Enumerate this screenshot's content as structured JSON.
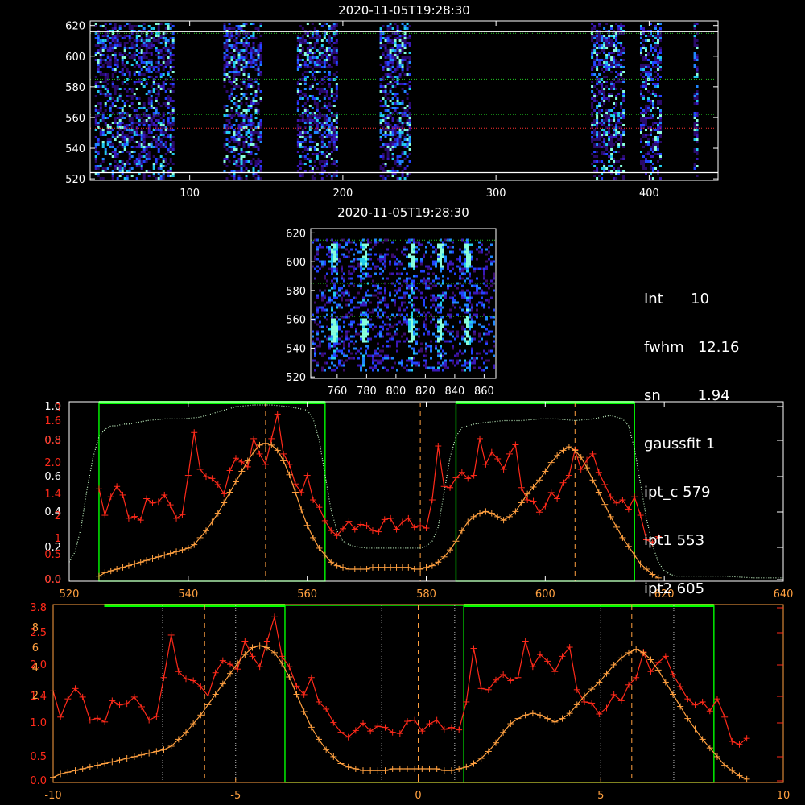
{
  "colors": {
    "axis": "#ffffff",
    "red": "#ff2a1a",
    "orange": "#ffa040",
    "green": "#00ff00",
    "green_dot": "#ccffcc",
    "dim_dot": "#bbbbbb"
  },
  "info": [
    {
      "key": "Int",
      "value": "10"
    },
    {
      "key": "fwhm",
      "value": "12.16"
    },
    {
      "key": "sn",
      "value": "1.94"
    },
    {
      "key": "gaussfit",
      "value": "1"
    },
    {
      "key": "ipt_c",
      "value": "579"
    },
    {
      "key": "ipt1",
      "value": "553"
    },
    {
      "key": "ipt2",
      "value": "605"
    }
  ],
  "chart_data": [
    {
      "type": "heatmap",
      "title": "2020-11-05T19:28:30",
      "xlim": [
        35,
        445
      ],
      "ylim": [
        519,
        623
      ],
      "xticks": [
        100,
        200,
        300,
        400
      ],
      "yticks": [
        520,
        540,
        560,
        580,
        600,
        620
      ],
      "bands": [
        [
          38,
          90
        ],
        [
          122,
          146
        ],
        [
          170,
          196
        ],
        [
          224,
          244
        ],
        [
          362,
          384
        ],
        [
          394,
          408
        ],
        [
          429,
          432
        ]
      ],
      "hlines": [
        {
          "y": 616,
          "color": "white"
        },
        {
          "y": 524,
          "color": "white"
        },
        {
          "y": 615,
          "color": "green"
        },
        {
          "y": 585,
          "color": "green"
        },
        {
          "y": 562,
          "color": "green"
        },
        {
          "y": 553,
          "color": "red"
        }
      ]
    },
    {
      "type": "heatmap",
      "title": "2020-11-05T19:28:30",
      "xlim": [
        742,
        868
      ],
      "ylim": [
        519,
        623
      ],
      "xticks": [
        760,
        780,
        800,
        820,
        840,
        860
      ],
      "yticks": [
        520,
        540,
        560,
        580,
        600,
        620
      ],
      "hot_columns": [
        757,
        778,
        810,
        830,
        848
      ],
      "hlines": [
        {
          "y": 615,
          "color": "green"
        },
        {
          "y": 585,
          "color": "green"
        },
        {
          "y": 562,
          "color": "green"
        }
      ]
    },
    {
      "type": "line",
      "xlim": [
        520,
        640
      ],
      "xticks": [
        520,
        540,
        560,
        580,
        600,
        620,
        640
      ],
      "left_ticks_red": [
        "0.0",
        "0.5",
        "1",
        "2",
        "1.4",
        "2.0",
        "0.8",
        "1.6",
        "3"
      ],
      "left_ticks_white": [
        "0.0",
        "0.2",
        "0.4",
        "0.6",
        "0.8",
        "1.0"
      ],
      "green_boxes": [
        [
          525,
          563
        ],
        [
          585,
          615
        ]
      ],
      "vlines_dashed": [
        553,
        579,
        605
      ],
      "series": [
        {
          "role": "red",
          "x": [
            525,
            526,
            527,
            528,
            529,
            530,
            531,
            532,
            533,
            534,
            535,
            536,
            537,
            538,
            539,
            540,
            541,
            542,
            543,
            544,
            545,
            546,
            547,
            548,
            549,
            550,
            551,
            552,
            553,
            554,
            555,
            556,
            557,
            558,
            559,
            560,
            561,
            562,
            563,
            564,
            565,
            566,
            567,
            568,
            569,
            570,
            571,
            572,
            573,
            574,
            575,
            576,
            577,
            578,
            579,
            580,
            581,
            582,
            583,
            584,
            585,
            586,
            587,
            588,
            589,
            590,
            591,
            592,
            593,
            594,
            595,
            596,
            597,
            598,
            599,
            600,
            601,
            602,
            603,
            604,
            605,
            606,
            607,
            608,
            609,
            610,
            611,
            612,
            613,
            614,
            615,
            616,
            617,
            618,
            619
          ],
          "y": [
            1.48,
            1.05,
            1.35,
            1.52,
            1.38,
            1.0,
            1.03,
            0.97,
            1.32,
            1.25,
            1.27,
            1.38,
            1.22,
            1.0,
            1.06,
            1.7,
            2.4,
            1.8,
            1.68,
            1.65,
            1.55,
            1.4,
            1.78,
            1.98,
            1.92,
            1.84,
            2.3,
            2.05,
            1.88,
            2.3,
            2.7,
            2.05,
            1.88,
            1.56,
            1.42,
            1.7,
            1.3,
            1.18,
            0.96,
            0.8,
            0.72,
            0.83,
            0.95,
            0.82,
            0.9,
            0.88,
            0.8,
            0.78,
            0.98,
            1.0,
            0.82,
            0.94,
            1.0,
            0.85,
            0.88,
            0.84,
            1.3,
            2.18,
            1.52,
            1.5,
            1.66,
            1.75,
            1.65,
            1.7,
            2.3,
            1.88,
            2.08,
            1.97,
            1.8,
            2.05,
            2.2,
            1.5,
            1.3,
            1.28,
            1.1,
            1.2,
            1.42,
            1.32,
            1.58,
            1.7,
            2.12,
            1.8,
            1.95,
            2.05,
            1.75,
            1.55,
            1.35,
            1.25,
            1.3,
            1.15,
            1.35,
            1.05,
            0.65,
            0.6,
            0.7
          ]
        },
        {
          "role": "orange",
          "x": [
            525,
            526,
            527,
            528,
            529,
            530,
            531,
            532,
            533,
            534,
            535,
            536,
            537,
            538,
            539,
            540,
            541,
            542,
            543,
            544,
            545,
            546,
            547,
            548,
            549,
            550,
            551,
            552,
            553,
            554,
            555,
            556,
            557,
            558,
            559,
            560,
            561,
            562,
            563,
            564,
            565,
            566,
            567,
            568,
            569,
            570,
            571,
            572,
            573,
            574,
            575,
            576,
            577,
            578,
            579,
            580,
            581,
            582,
            583,
            584,
            585,
            586,
            587,
            588,
            589,
            590,
            591,
            592,
            593,
            594,
            595,
            596,
            597,
            598,
            599,
            600,
            601,
            602,
            603,
            604,
            605,
            606,
            607,
            608,
            609,
            610,
            611,
            612,
            613,
            614,
            615,
            616,
            617,
            618,
            619
          ],
          "y": [
            0.02,
            0.04,
            0.05,
            0.06,
            0.07,
            0.08,
            0.09,
            0.1,
            0.11,
            0.12,
            0.13,
            0.14,
            0.15,
            0.16,
            0.17,
            0.18,
            0.2,
            0.24,
            0.28,
            0.33,
            0.38,
            0.44,
            0.5,
            0.56,
            0.62,
            0.68,
            0.73,
            0.77,
            0.78,
            0.77,
            0.74,
            0.68,
            0.6,
            0.5,
            0.4,
            0.31,
            0.24,
            0.18,
            0.14,
            0.1,
            0.08,
            0.07,
            0.06,
            0.06,
            0.06,
            0.06,
            0.07,
            0.07,
            0.07,
            0.07,
            0.07,
            0.07,
            0.07,
            0.06,
            0.06,
            0.07,
            0.08,
            0.1,
            0.13,
            0.17,
            0.22,
            0.28,
            0.33,
            0.36,
            0.38,
            0.39,
            0.38,
            0.36,
            0.34,
            0.36,
            0.39,
            0.44,
            0.49,
            0.53,
            0.57,
            0.62,
            0.67,
            0.71,
            0.74,
            0.76,
            0.74,
            0.7,
            0.64,
            0.57,
            0.5,
            0.43,
            0.36,
            0.3,
            0.24,
            0.19,
            0.14,
            0.09,
            0.06,
            0.03,
            0.01
          ]
        },
        {
          "role": "green_dotted",
          "x": [
            520,
            521,
            522,
            523,
            524,
            525,
            526,
            527,
            528,
            529,
            530,
            533,
            536,
            539,
            542,
            545,
            548,
            551,
            554,
            557,
            560,
            561,
            562,
            563,
            564,
            565,
            566,
            567,
            568,
            570,
            573,
            576,
            579,
            580,
            581,
            582,
            583,
            584,
            585,
            586,
            587,
            588,
            590,
            593,
            596,
            599,
            602,
            605,
            608,
            611,
            613,
            614,
            615,
            616,
            617,
            618,
            619,
            620,
            621,
            622,
            623,
            625,
            630,
            635,
            640
          ],
          "y": [
            0.1,
            0.16,
            0.3,
            0.52,
            0.7,
            0.82,
            0.86,
            0.88,
            0.88,
            0.89,
            0.89,
            0.91,
            0.92,
            0.92,
            0.93,
            0.96,
            0.99,
            1.0,
            1.0,
            0.99,
            0.97,
            0.92,
            0.8,
            0.6,
            0.4,
            0.28,
            0.22,
            0.2,
            0.19,
            0.18,
            0.18,
            0.18,
            0.18,
            0.19,
            0.22,
            0.3,
            0.5,
            0.7,
            0.82,
            0.87,
            0.88,
            0.89,
            0.9,
            0.91,
            0.91,
            0.92,
            0.92,
            0.91,
            0.92,
            0.94,
            0.92,
            0.88,
            0.75,
            0.55,
            0.35,
            0.2,
            0.1,
            0.05,
            0.03,
            0.02,
            0.02,
            0.02,
            0.02,
            0.01,
            0.01
          ]
        }
      ]
    },
    {
      "type": "line",
      "xlim": [
        -10,
        10
      ],
      "xticks": [
        -10,
        -5,
        0,
        5,
        10
      ],
      "left_ticks_red": [
        "0.0",
        "0.5",
        "1.0",
        "1.4",
        "2.0",
        "2.5",
        "3.8"
      ],
      "left_ticks_orange": [
        "2",
        "4",
        "6",
        "8"
      ],
      "green_boxes": [
        [
          -3.65,
          1.25
        ],
        [
          1.25,
          8.1
        ]
      ],
      "vlines_dashed": [
        -5.85,
        0.0,
        5.85
      ],
      "vlines_dotted": [
        -7.0,
        -5.0,
        -1.0,
        1.0,
        5.0,
        7.0
      ]
    }
  ]
}
